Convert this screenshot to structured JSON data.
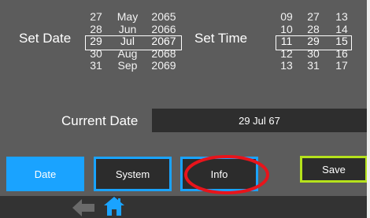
{
  "set_date": {
    "label": "Set Date",
    "day": [
      "27",
      "28",
      "29",
      "30",
      "31"
    ],
    "month": [
      "May",
      "Jun",
      "Jul",
      "Aug",
      "Sep"
    ],
    "year": [
      "2065",
      "2066",
      "2067",
      "2068",
      "2069"
    ],
    "selected_index": 2
  },
  "set_time": {
    "label": "Set Time",
    "hour": [
      "09",
      "10",
      "11",
      "12",
      "13"
    ],
    "minute": [
      "27",
      "28",
      "29",
      "30",
      "31"
    ],
    "second": [
      "13",
      "14",
      "15",
      "16",
      "17"
    ],
    "selected_index": 2
  },
  "current_date": {
    "label": "Current Date",
    "value": "29 Jul 67"
  },
  "tabs": {
    "date": "Date",
    "system": "System",
    "info": "Info"
  },
  "save_label": "Save",
  "nav": {
    "back_icon": "back-arrow-icon",
    "home_icon": "home-icon"
  },
  "colors": {
    "background": "#5c5c5c",
    "active_tab": "#1aa3ff",
    "tab_border": "#1aa3ff",
    "save_border": "#b5e21c",
    "annotation_ring": "#e8141b",
    "home_icon": "#1aa3ff"
  }
}
